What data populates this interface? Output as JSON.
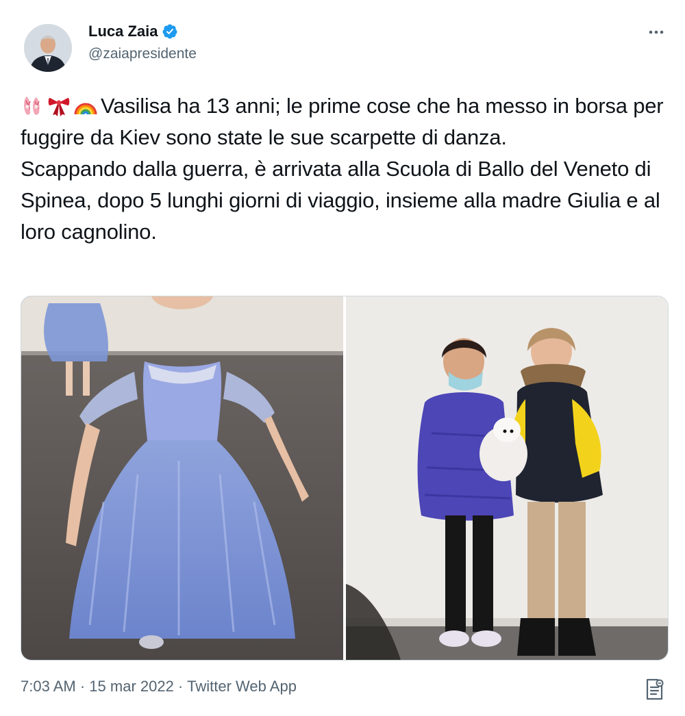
{
  "author": {
    "display_name": "Luca Zaia",
    "handle": "@zaiapresidente",
    "verified": true
  },
  "icons": {
    "avatar": "profile-photo",
    "verified": "verified-badge-icon",
    "more": "more-options-icon",
    "analytics": "tweet-analytics-icon",
    "emoji": [
      "ballet-shoes-emoji",
      "ribbon-emoji",
      "rainbow-emoji"
    ]
  },
  "tweet": {
    "line1": "Vasilisa ha 13 anni; le prime cose che ha messo in borsa per fuggire da Kiev sono state le sue scarpette di danza.",
    "line2": "Scappando dalla guerra, è arrivata alla Scuola di Ballo del Veneto di Spinea, dopo 5 lunghi giorni di viaggio, insieme alla madre Giulia e al loro cagnolino."
  },
  "media": [
    {
      "name": "ballerina-photo"
    },
    {
      "name": "girls-with-dog-photo"
    }
  ],
  "meta": {
    "time": "7:03 AM",
    "separator": "·",
    "date": "15 mar 2022",
    "source": "Twitter Web App"
  },
  "colors": {
    "text": "#0f1419",
    "secondary": "#536471",
    "verified": "#1d9bf0",
    "border": "#cfd9de"
  }
}
